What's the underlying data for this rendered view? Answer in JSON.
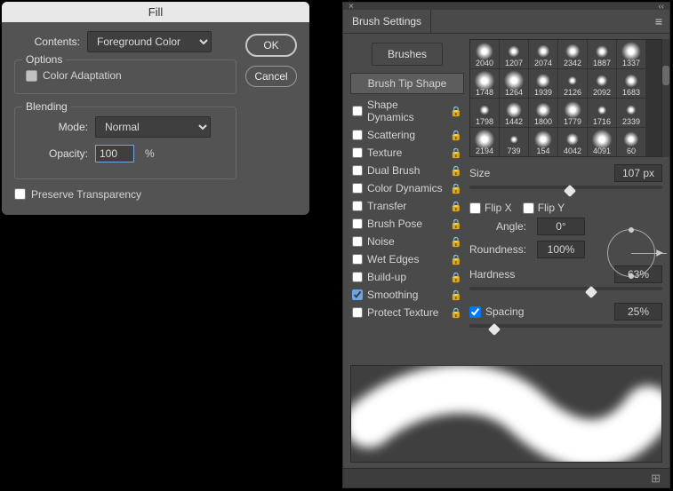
{
  "fill": {
    "title": "Fill",
    "contents_label": "Contents:",
    "contents_value": "Foreground Color",
    "ok": "OK",
    "cancel": "Cancel",
    "options_legend": "Options",
    "color_adaptation": "Color Adaptation",
    "blending_legend": "Blending",
    "mode_label": "Mode:",
    "mode_value": "Normal",
    "opacity_label": "Opacity:",
    "opacity_value": "100",
    "percent": "%",
    "preserve": "Preserve Transparency"
  },
  "brush": {
    "tab": "Brush Settings",
    "brushes_btn": "Brushes",
    "tip_shape": "Brush Tip Shape",
    "options": [
      {
        "label": "Shape Dynamics",
        "checked": false
      },
      {
        "label": "Scattering",
        "checked": false
      },
      {
        "label": "Texture",
        "checked": false
      },
      {
        "label": "Dual Brush",
        "checked": false
      },
      {
        "label": "Color Dynamics",
        "checked": false
      },
      {
        "label": "Transfer",
        "checked": false
      },
      {
        "label": "Brush Pose",
        "checked": false
      },
      {
        "label": "Noise",
        "checked": false
      },
      {
        "label": "Wet Edges",
        "checked": false
      },
      {
        "label": "Build-up",
        "checked": false
      },
      {
        "label": "Smoothing",
        "checked": true
      },
      {
        "label": "Protect Texture",
        "checked": false
      }
    ],
    "presets": [
      "2040",
      "1207",
      "2074",
      "2342",
      "1887",
      "1337",
      "1748",
      "1264",
      "1939",
      "2126",
      "2092",
      "1683",
      "1798",
      "1442",
      "1800",
      "1779",
      "1716",
      "2339",
      "2194",
      "739",
      "154",
      "4042",
      "4091",
      "60"
    ],
    "size_label": "Size",
    "size_value": "107 px",
    "flip_x": "Flip X",
    "flip_y": "Flip Y",
    "angle_label": "Angle:",
    "angle_value": "0°",
    "roundness_label": "Roundness:",
    "roundness_value": "100%",
    "hardness_label": "Hardness",
    "hardness_value": "63%",
    "spacing_label": "Spacing",
    "spacing_value": "25%"
  }
}
